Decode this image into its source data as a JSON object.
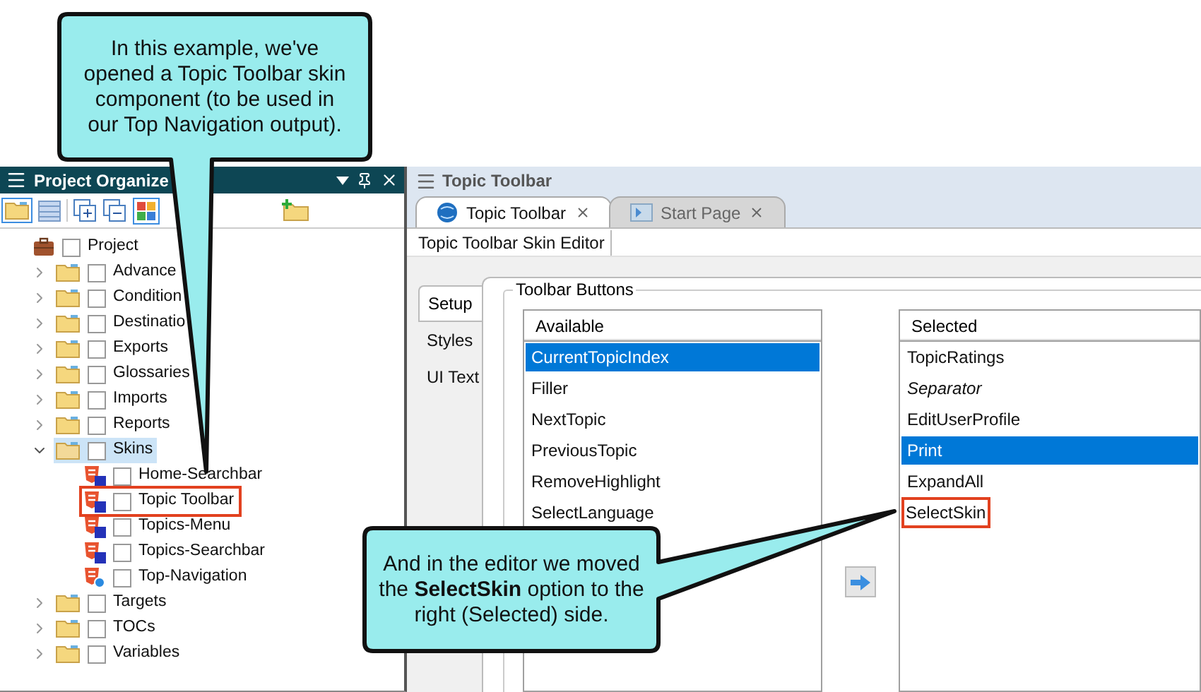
{
  "callouts": [
    {
      "text": "In this example, we've opened a Topic Toolbar skin component (to be used in our Top Navigation output)."
    },
    {
      "text": "And in the editor we moved the **SelectSkin** option to the right (Selected) side."
    }
  ],
  "project_organizer": {
    "title": "Project Organize",
    "tree": [
      {
        "label": "Project",
        "kind": "project",
        "selected": false,
        "highlighted": false,
        "children": [
          {
            "label": "Advance",
            "kind": "folder",
            "expanded": false,
            "selected": false,
            "highlighted": false
          },
          {
            "label": "Condition",
            "kind": "folder",
            "expanded": false,
            "selected": false,
            "highlighted": false
          },
          {
            "label": "Destinatio",
            "kind": "folder",
            "expanded": false,
            "selected": false,
            "highlighted": false
          },
          {
            "label": "Exports",
            "kind": "folder",
            "expanded": false,
            "selected": false,
            "highlighted": false
          },
          {
            "label": "Glossaries",
            "kind": "folder",
            "expanded": false,
            "selected": false,
            "highlighted": false
          },
          {
            "label": "Imports",
            "kind": "folder",
            "expanded": false,
            "selected": false,
            "highlighted": false
          },
          {
            "label": "Reports",
            "kind": "folder",
            "expanded": false,
            "selected": false,
            "highlighted": false
          },
          {
            "label": "Skins",
            "kind": "folder",
            "expanded": true,
            "selected": true,
            "highlighted": false,
            "children": [
              {
                "label": "Home-Searchbar",
                "kind": "component",
                "selected": false,
                "highlighted": false
              },
              {
                "label": "Topic Toolbar",
                "kind": "component",
                "selected": false,
                "highlighted": true
              },
              {
                "label": "Topics-Menu",
                "kind": "component",
                "selected": false,
                "highlighted": false
              },
              {
                "label": "Topics-Searchbar",
                "kind": "component",
                "selected": false,
                "highlighted": false
              },
              {
                "label": "Top-Navigation",
                "kind": "skin",
                "selected": false,
                "highlighted": false
              }
            ]
          },
          {
            "label": "Targets",
            "kind": "folder",
            "expanded": false,
            "selected": false,
            "highlighted": false
          },
          {
            "label": "TOCs",
            "kind": "folder",
            "expanded": false,
            "selected": false,
            "highlighted": false
          },
          {
            "label": "Variables",
            "kind": "folder",
            "expanded": false,
            "selected": false,
            "highlighted": false
          }
        ]
      }
    ]
  },
  "editor": {
    "title": "Topic Toolbar",
    "tabs": [
      {
        "label": "Topic Toolbar",
        "selected": true
      },
      {
        "label": "Start Page",
        "selected": false
      }
    ],
    "editor_title": "Topic Toolbar Skin Editor",
    "side_tabs": [
      {
        "label": "Setup",
        "selected": true
      },
      {
        "label": "Styles",
        "selected": false
      },
      {
        "label": "UI Text",
        "selected": false
      }
    ],
    "group_title": "Toolbar Buttons",
    "available": {
      "header": "Available",
      "items": [
        {
          "label": "CurrentTopicIndex",
          "selected": true,
          "highlighted": false
        },
        {
          "label": "Filler",
          "selected": false,
          "highlighted": false
        },
        {
          "label": "NextTopic",
          "selected": false,
          "highlighted": false
        },
        {
          "label": "PreviousTopic",
          "selected": false,
          "highlighted": false
        },
        {
          "label": "RemoveHighlight",
          "selected": false,
          "highlighted": false
        },
        {
          "label": "SelectLanguage",
          "selected": false,
          "highlighted": false
        }
      ]
    },
    "selected": {
      "header": "Selected",
      "items": [
        {
          "label": "TopicRatings",
          "kind": "button",
          "selected": false,
          "highlighted": false
        },
        {
          "label": "Separator",
          "kind": "separator",
          "selected": false,
          "highlighted": false
        },
        {
          "label": "EditUserProfile",
          "kind": "button",
          "selected": false,
          "highlighted": false
        },
        {
          "label": "Print",
          "kind": "button",
          "selected": true,
          "highlighted": false
        },
        {
          "label": "ExpandAll",
          "kind": "button",
          "selected": false,
          "highlighted": false
        },
        {
          "label": "SelectSkin",
          "kind": "button",
          "selected": false,
          "highlighted": true
        }
      ]
    }
  }
}
